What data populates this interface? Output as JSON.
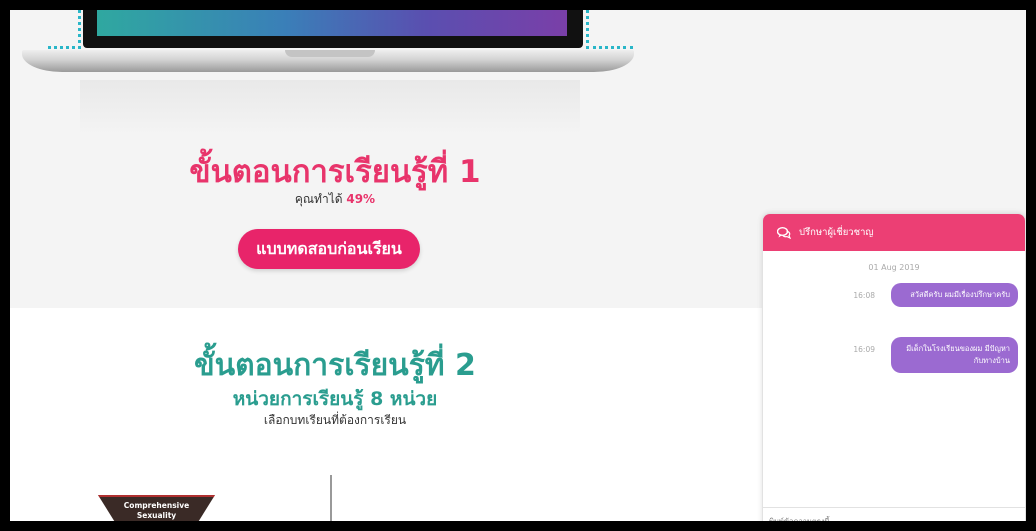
{
  "step1": {
    "title": "ขั้นตอนการเรียนรู้ที่ 1",
    "score_label": "คุณทำได้",
    "score_value": "49%",
    "pretest_button": "แบบทดสอบก่อนเรียน"
  },
  "step2": {
    "title": "ขั้นตอนการเรียนรู้ที่ 2",
    "subtitle": "หน่วยการเรียนรู้ 8 หน่วย",
    "hint": "เลือกบทเรียนที่ต้องการเรียน",
    "module_label_line1": "Comprehensive",
    "module_label_line2": "Sexuality"
  },
  "chat": {
    "header_title": "ปรึกษาผู้เชี่ยวชาญ",
    "header_icon": "chat-bubbles-icon",
    "date": "01 Aug 2019",
    "messages": [
      {
        "time": "16:08",
        "text": "สวัสดีครับ ผมมีเรื่องปรึกษาครับ"
      },
      {
        "time": "16:09",
        "text": "มีเด็กในโรงเรียนของผม มีปัญหากับทางบ้าน"
      }
    ],
    "input_placeholder": "พิมพ์ข้อความตรงนี้..."
  },
  "colors": {
    "primary_pink": "#e8346b",
    "teal": "#2a9d8f",
    "bubble_purple": "#9b6ad1"
  }
}
